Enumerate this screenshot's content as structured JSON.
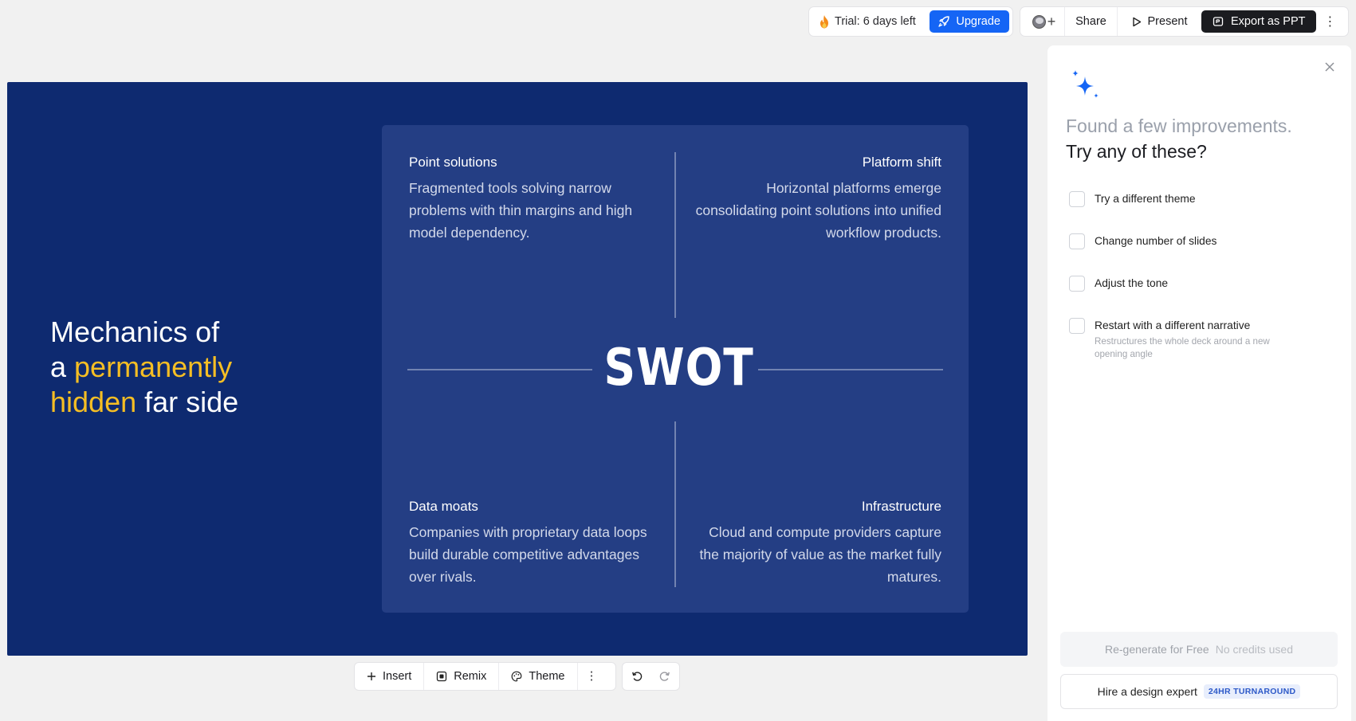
{
  "topbar": {
    "trial_text": "Trial: 6 days left",
    "upgrade_label": "Upgrade",
    "share_label": "Share",
    "present_label": "Present",
    "export_label": "Export as PPT"
  },
  "slide": {
    "title_part1": "Mechanics of",
    "title_part2": "a ",
    "title_highlight1": "permanently",
    "title_highlight2": "hidden",
    "title_part3": " far side",
    "center_label": "SWOT",
    "quadrants": [
      {
        "heading": "Point solutions",
        "body": "Fragmented tools solving narrow problems with thin margins and high model dependency."
      },
      {
        "heading": "Platform shift",
        "body": "Horizontal platforms emerge consolidating point solutions into unified workflow products."
      },
      {
        "heading": "Data moats",
        "body": "Companies with proprietary data loops build durable competitive advantages over rivals."
      },
      {
        "heading": "Infrastructure",
        "body": "Cloud and compute providers capture the majority of value as the market fully matures."
      }
    ],
    "colors": {
      "background": "#0e2a70",
      "panel": "#243e84",
      "highlight": "#f5be24"
    }
  },
  "toolbar": {
    "insert_label": "Insert",
    "remix_label": "Remix",
    "theme_label": "Theme"
  },
  "panel": {
    "line1": "Found a few improvements.",
    "line2": "Try any of these?",
    "options": [
      {
        "label": "Try a different theme"
      },
      {
        "label": "Change number of slides"
      },
      {
        "label": "Adjust the tone"
      },
      {
        "label": "Restart with a different narrative",
        "sub": "Restructures the whole deck around a new opening angle"
      }
    ],
    "regen_label": "Re-generate for Free",
    "regen_sub": "No credits used",
    "hire_label": "Hire a design expert",
    "hire_badge": "24HR TURNAROUND"
  }
}
